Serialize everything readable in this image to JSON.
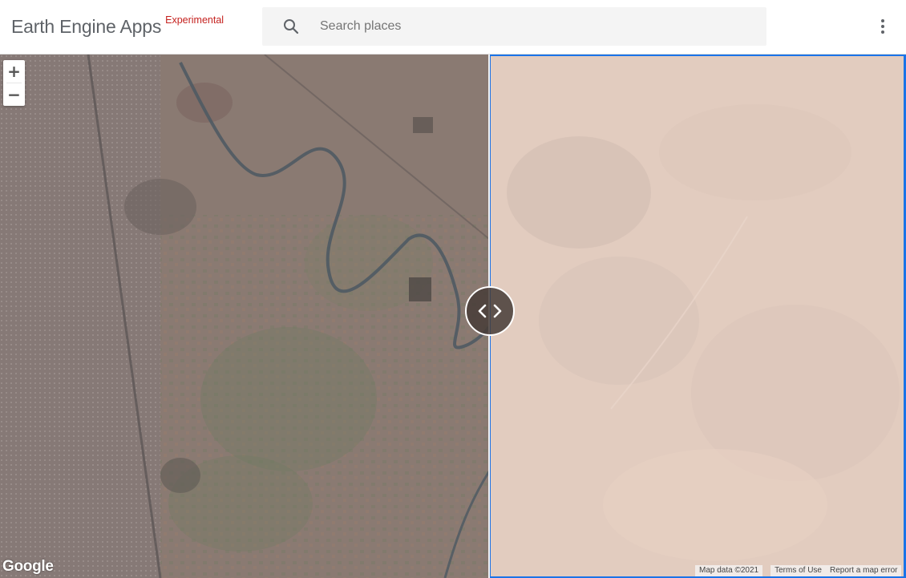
{
  "header": {
    "title": "Earth Engine Apps",
    "tag": "Experimental",
    "search": {
      "placeholder": "Search places",
      "value": ""
    },
    "menu_icon": "more-vert-icon"
  },
  "map": {
    "zoom_in_label": "+",
    "zoom_out_label": "−",
    "swipe_icon": "chevron-left-right-icon",
    "google_logo": "Google",
    "attribution": {
      "map_data": "Map data ©2021",
      "terms": "Terms of Use",
      "report": "Report a map error"
    }
  },
  "colors": {
    "accent_border": "#1a73e8",
    "experimental_tag": "#c5221f",
    "left_imagery_base": "#8c7b72",
    "right_imagery_base": "#e2ccbf"
  }
}
